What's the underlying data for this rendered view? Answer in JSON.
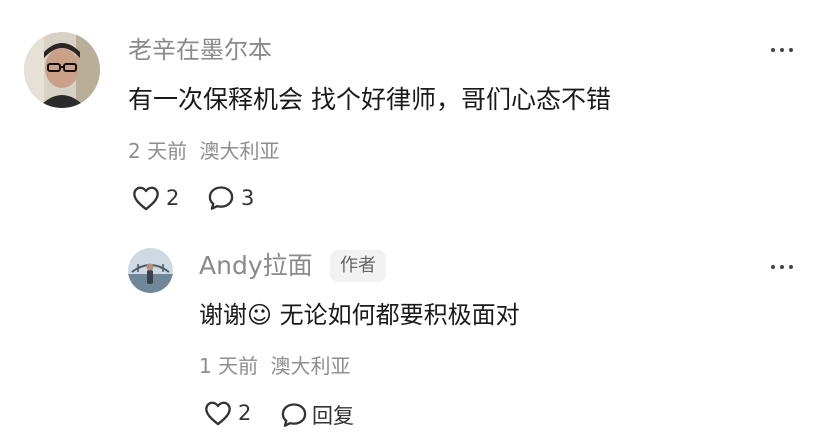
{
  "comment": {
    "author": "老辛在墨尔本",
    "text": "有一次保释机会 找个好律师，哥们心态不错",
    "time": "2 天前",
    "location": "澳大利亚",
    "likes": "2",
    "replies": "3"
  },
  "reply": {
    "author": "Andy拉面",
    "badge": "作者",
    "text": "谢谢☺ 无论如何都要积极面对",
    "time": "1 天前",
    "location": "澳大利亚",
    "likes": "2",
    "reply_label": "回复"
  },
  "icons": {
    "like": "heart-outline-icon",
    "comment": "speech-bubble-icon",
    "more": "more-dots-icon"
  },
  "colors": {
    "text": "#1a1a1a",
    "secondary": "#8e8e8e",
    "badge_bg": "#f2f2f2"
  }
}
